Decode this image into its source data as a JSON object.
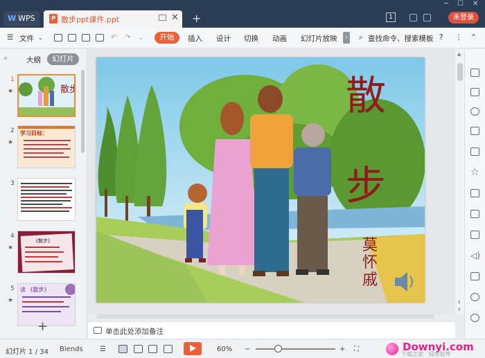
{
  "titlebar": {
    "app_tab": "WPS",
    "app_logo": "W",
    "doc_tab": "散步ppt课件.ppt",
    "doc_icon": "P",
    "add_tab": "+",
    "close": "✕",
    "page_badge": "1",
    "login": "未登录"
  },
  "menubar": {
    "file": "文件",
    "tabs": [
      "开始",
      "插入",
      "设计",
      "切换",
      "动画",
      "幻灯片放映"
    ],
    "search": "查找命令、搜索模板",
    "help": "?",
    "more": "⋮",
    "collapse": "⌃"
  },
  "leftpanel": {
    "collapse": "«",
    "outline": "大纲",
    "slides": "幻灯片",
    "thumbs": [
      {
        "num": "1",
        "title": "散步"
      },
      {
        "num": "2",
        "title": "学习目标："
      },
      {
        "num": "3",
        "title": ""
      },
      {
        "num": "4",
        "title": "《散步》"
      },
      {
        "num": "5",
        "title": "读 《散步》"
      }
    ],
    "add": "+"
  },
  "slide": {
    "title_char1": "散",
    "title_char2": "步",
    "author1": "莫",
    "author2": "怀",
    "author3": "戚"
  },
  "notes": {
    "placeholder": "单击此处添加备注"
  },
  "status": {
    "slide_count": "幻灯片 1 / 34",
    "theme": "Blends",
    "zoom": "60%",
    "minus": "−",
    "plus": "+"
  },
  "watermark": {
    "text": "Downyi.com",
    "sub": "下载之家 · 绿色软件"
  }
}
